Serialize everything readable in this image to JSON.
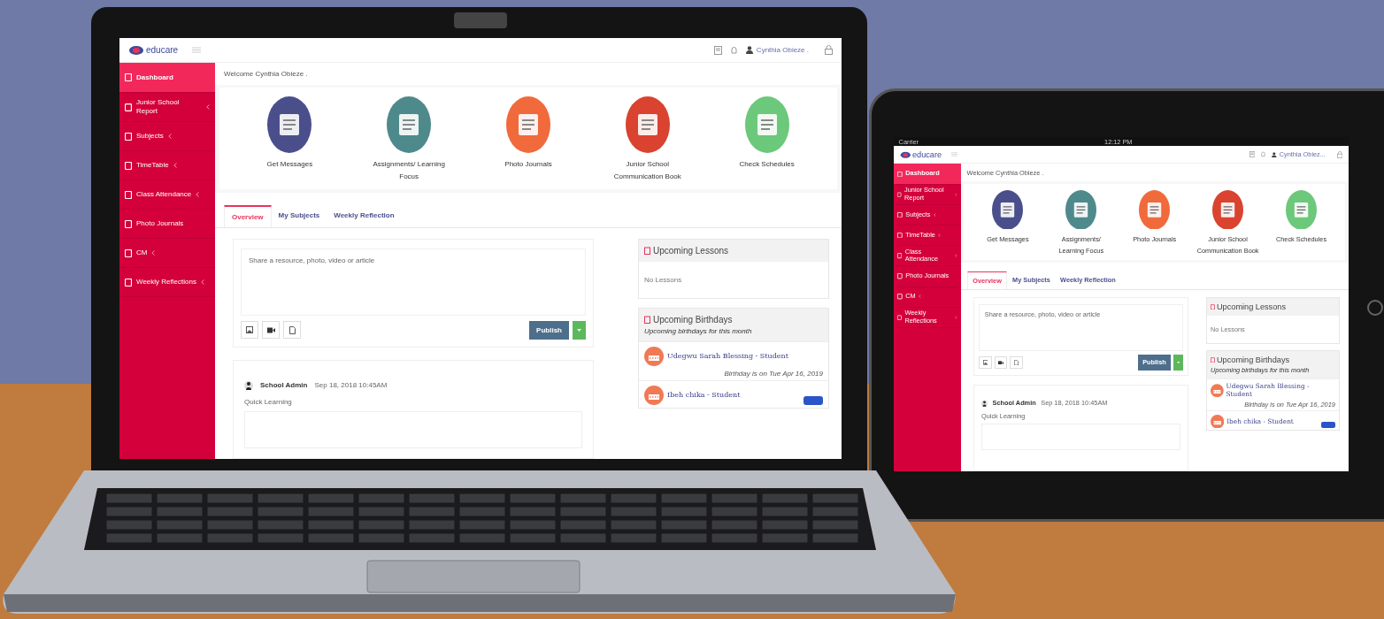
{
  "screens": [
    {
      "kind": "laptop",
      "header": {
        "logo": "educare",
        "user": "Cynthia Obieze ."
      },
      "sidebar": [
        {
          "label": "Dashboard",
          "selected": true,
          "expandable": false
        },
        {
          "label": "Junior School Report",
          "selected": false,
          "expandable": true
        },
        {
          "label": "Subjects",
          "selected": false,
          "expandable": true
        },
        {
          "label": "TimeTable",
          "selected": false,
          "expandable": true
        },
        {
          "label": "Class Attendance",
          "selected": false,
          "expandable": true
        },
        {
          "label": "Photo Journals",
          "selected": false,
          "expandable": false
        },
        {
          "label": "CM",
          "selected": false,
          "expandable": true
        },
        {
          "label": "Weekly Reflections",
          "selected": false,
          "expandable": true
        }
      ],
      "welcome": "Welcome Cynthia Obieze .",
      "shortcuts": [
        {
          "label": "Get Messages",
          "color": "#4a4f8c"
        },
        {
          "label": "Assignments/ Learning Focus",
          "color": "#4e8a8c"
        },
        {
          "label": "Photo Journals",
          "color": "#f06a3c"
        },
        {
          "label": "Junior School Communication Book",
          "color": "#d9432f"
        },
        {
          "label": "Check Schedules",
          "color": "#6cc87a"
        }
      ],
      "tabs": [
        {
          "label": "Overview",
          "selected": true
        },
        {
          "label": "My Subjects",
          "selected": false
        },
        {
          "label": "Weekly Reflection",
          "selected": false
        }
      ],
      "composer": {
        "placeholder": "Share a resource, photo, video or article",
        "publish": "Publish"
      },
      "post": {
        "author": "School Admin",
        "time": "Sep 18, 2018 10:45AM",
        "text": "Quick Learning"
      },
      "lessons": {
        "title": "Upcoming Lessons",
        "empty": "No Lessons"
      },
      "birthdays": {
        "title": "Upcoming Birthdays",
        "subtitle": "Upcoming birthdays for this month",
        "items": [
          {
            "name": "Udegwu Sarah Blessing - Student",
            "date": "Birthday is on Tue Apr 16, 2019"
          },
          {
            "name": "Ibeh chika - Student"
          }
        ]
      }
    },
    {
      "kind": "tablet",
      "status_bar": {
        "carrier": "Carrier",
        "time": "12:12 PM"
      },
      "header": {
        "logo": "educare",
        "user": "Cynthia Obiez..."
      },
      "sidebar": [
        {
          "label": "Dashboard",
          "selected": true,
          "expandable": false
        },
        {
          "label": "Junior School Report",
          "selected": false,
          "expandable": true
        },
        {
          "label": "Subjects",
          "selected": false,
          "expandable": true
        },
        {
          "label": "TimeTable",
          "selected": false,
          "expandable": true
        },
        {
          "label": "Class Attendance",
          "selected": false,
          "expandable": true
        },
        {
          "label": "Photo Journals",
          "selected": false,
          "expandable": false
        },
        {
          "label": "CM",
          "selected": false,
          "expandable": true
        },
        {
          "label": "Weekly Reflections",
          "selected": false,
          "expandable": true
        }
      ],
      "welcome": "Welcome Cynthia Obieze .",
      "shortcuts": [
        {
          "label": "Get Messages",
          "color": "#4a4f8c"
        },
        {
          "label": "Assignments/ Learning Focus",
          "color": "#4e8a8c"
        },
        {
          "label": "Photo Journals",
          "color": "#f06a3c"
        },
        {
          "label": "Junior School Communication Book",
          "color": "#d9432f"
        },
        {
          "label": "Check Schedules",
          "color": "#6cc87a"
        }
      ],
      "tabs": [
        {
          "label": "Overview",
          "selected": true
        },
        {
          "label": "My Subjects",
          "selected": false
        },
        {
          "label": "Weekly Reflection",
          "selected": false
        }
      ],
      "composer": {
        "placeholder": "Share a resource, photo, video or article",
        "publish": "Publish"
      },
      "post": {
        "author": "School Admin",
        "time": "Sep 18, 2018 10:45AM",
        "text": "Quick Learning"
      },
      "lessons": {
        "title": "Upcoming Lessons",
        "empty": "No Lessons"
      },
      "birthdays": {
        "title": "Upcoming Birthdays",
        "subtitle": "Upcoming birthdays for this month",
        "items": [
          {
            "name": "Udegwu Sarah Blessing - Student",
            "date": "Birthday is on Tue Apr 16, 2019"
          },
          {
            "name": "Ibeh chika - Student"
          }
        ]
      }
    }
  ]
}
